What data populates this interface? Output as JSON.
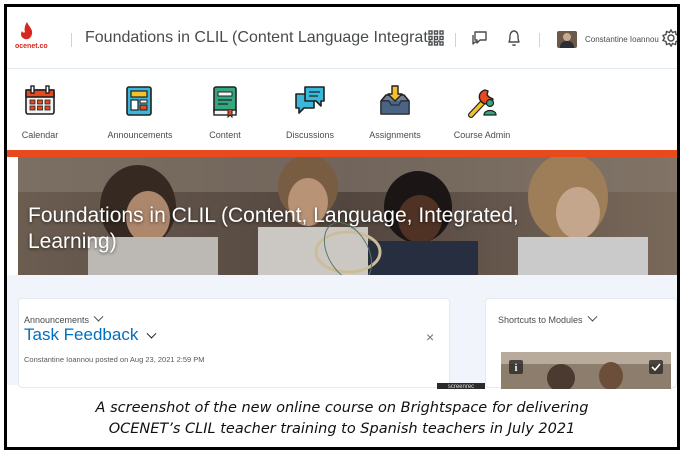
{
  "header": {
    "logo_text": "ocenet.co",
    "course_title": "Foundations in CLIL (Content Language Integrat...",
    "user_name": "Constantine Ioannou"
  },
  "nav": {
    "items": [
      {
        "label": "Calendar",
        "icon": "calendar-icon"
      },
      {
        "label": "Announcements",
        "icon": "announcements-icon"
      },
      {
        "label": "Content",
        "icon": "book-icon"
      },
      {
        "label": "Discussions",
        "icon": "chat-bubbles-icon"
      },
      {
        "label": "Assignments",
        "icon": "inbox-download-icon"
      },
      {
        "label": "Course Admin",
        "icon": "wrench-person-icon"
      }
    ]
  },
  "banner": {
    "title": "Foundations in CLIL (Content, Language, Integrated, Learning)"
  },
  "announcements_widget": {
    "title": "Announcements",
    "item_title": "Task Feedback",
    "posted": "Constantine Ioannou posted on Aug 23, 2021 2:59 PM",
    "close": "×"
  },
  "shortcuts_widget": {
    "title": "Shortcuts to Modules"
  },
  "overlay": {
    "screenrec": "screenrec"
  },
  "caption": {
    "line1": "A screenshot of the new online course on Brightspace for delivering",
    "line2": "OCENET’s CLIL teacher training to Spanish teachers in July 2021"
  },
  "colors": {
    "accent_red": "#e8491d",
    "link_blue": "#006fbf",
    "banner_text": "#ffffff"
  }
}
